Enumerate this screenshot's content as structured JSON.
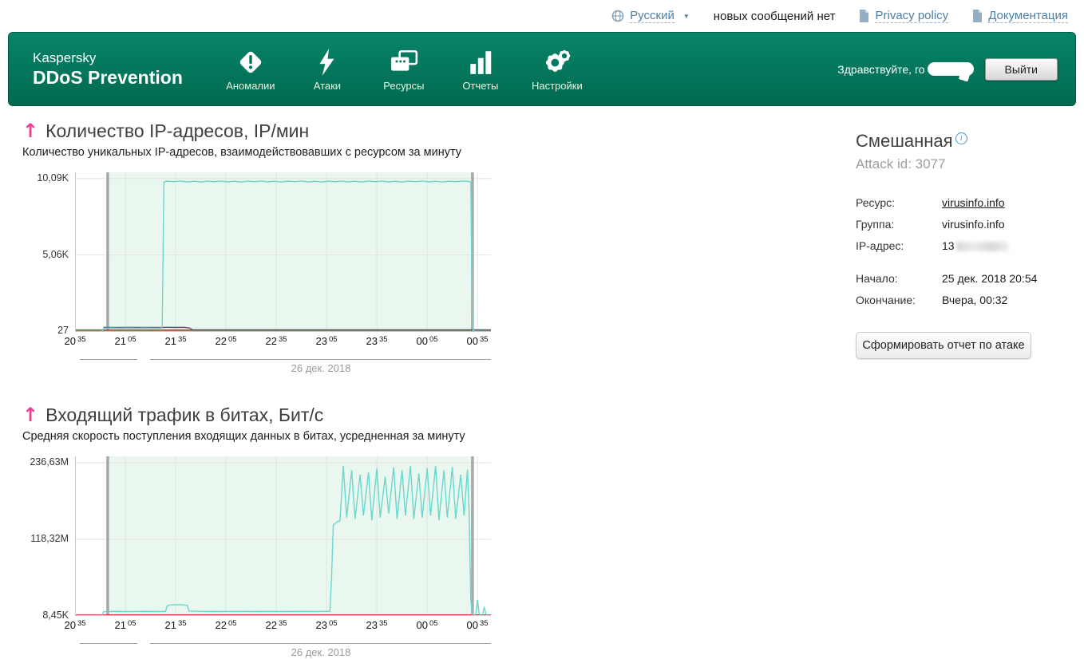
{
  "topbar": {
    "language": "Русский",
    "messages": "новых сообщений нет",
    "privacy": "Privacy policy",
    "docs": "Документация"
  },
  "header": {
    "brand_line1": "Kaspersky",
    "brand_line2": "DDoS Prevention",
    "nav": [
      {
        "label": "Аномалии",
        "icon": "diamond-exclamation"
      },
      {
        "label": "Атаки",
        "icon": "lightning"
      },
      {
        "label": "Ресурсы",
        "icon": "windows"
      },
      {
        "label": "Отчеты",
        "icon": "bar-chart"
      },
      {
        "label": "Настройки",
        "icon": "gears"
      }
    ],
    "greeting": "Здравствуйте, го",
    "logout": "Выйти"
  },
  "sidebar": {
    "title": "Смешанная",
    "attack_id": "Attack id: 3077",
    "fields": [
      {
        "label": "Ресурс:",
        "value": "virusinfo.info"
      },
      {
        "label": "Группа:",
        "value": "virusinfo.info"
      },
      {
        "label": "IP-адрес:",
        "value": "13"
      }
    ],
    "times": [
      {
        "label": "Начало:",
        "value": "25 дек. 2018 20:54"
      },
      {
        "label": "Окончание:",
        "value": "Вчера, 00:32"
      }
    ],
    "report_button": "Сформировать отчет по атаке"
  },
  "chart_data": [
    {
      "type": "line",
      "title": "Количество IP-адресов, IP/мин",
      "subtitle": "Количество уникальных IP-адресов, взаимодействовавших с ресурсом за минуту",
      "date_label": "26 дек. 2018",
      "x_start_time": "20:35",
      "xlim": [
        0,
        248
      ],
      "ylim": [
        0,
        10500
      ],
      "y_ticks": [
        {
          "label": "10,09K",
          "value": 10090
        },
        {
          "label": "5,06K",
          "value": 5060
        },
        {
          "label": "27",
          "value": 27
        }
      ],
      "x_ticks": [
        {
          "h": "20",
          "m": "35",
          "min": 0
        },
        {
          "h": "21",
          "m": "05",
          "min": 30
        },
        {
          "h": "21",
          "m": "35",
          "min": 60
        },
        {
          "h": "22",
          "m": "05",
          "min": 90
        },
        {
          "h": "22",
          "m": "35",
          "min": 120
        },
        {
          "h": "23",
          "m": "05",
          "min": 150
        },
        {
          "h": "23",
          "m": "35",
          "min": 180
        },
        {
          "h": "00",
          "m": "05",
          "min": 210
        },
        {
          "h": "00",
          "m": "35",
          "min": 240
        }
      ],
      "attack_region": {
        "start_min": 19.5,
        "end_min": 237
      },
      "colors": {
        "region": "#e9f7ee",
        "vgrid": "#d9eadf",
        "hgrid": "#e2e2e2",
        "marker": "#a8a8a8"
      },
      "series": [
        {
          "name": "green-baseline",
          "color": "#7cc25c",
          "width": 2,
          "points": [
            [
              0,
              55
            ],
            [
              248,
              55
            ]
          ]
        },
        {
          "name": "red-baseline",
          "color": "#bf4040",
          "width": 1.6,
          "points": [
            [
              0,
              120
            ],
            [
              248,
              120
            ]
          ]
        },
        {
          "name": "navy-line",
          "color": "#4a5b6e",
          "width": 1.4,
          "points": [
            [
              17,
              300
            ],
            [
              25,
              290
            ],
            [
              33,
              298
            ],
            [
              41,
              288
            ],
            [
              49,
              295
            ],
            [
              55,
              300
            ],
            [
              60,
              292
            ],
            [
              65,
              298
            ],
            [
              68,
              260
            ],
            [
              70,
              140
            ],
            [
              80,
              132
            ],
            [
              100,
              135
            ],
            [
              120,
              130
            ],
            [
              140,
              134
            ],
            [
              160,
              130
            ],
            [
              180,
              133
            ],
            [
              200,
              130
            ],
            [
              220,
              133
            ],
            [
              236,
              130
            ],
            [
              248,
              128
            ]
          ]
        },
        {
          "name": "ip-count",
          "color": "#68d7d0",
          "width": 1.4,
          "points": [
            [
              0,
              30
            ],
            [
              6,
              28
            ],
            [
              12,
              30
            ],
            [
              16,
              28
            ],
            [
              17,
              240
            ],
            [
              22,
              252
            ],
            [
              27,
              242
            ],
            [
              32,
              250
            ],
            [
              37,
              244
            ],
            [
              42,
              252
            ],
            [
              47,
              243
            ],
            [
              52,
              250
            ],
            [
              53,
              9860
            ],
            [
              55,
              9920
            ],
            [
              59,
              9880
            ],
            [
              63,
              9930
            ],
            [
              67,
              9870
            ],
            [
              71,
              9910
            ],
            [
              75,
              9860
            ],
            [
              79,
              9920
            ],
            [
              83,
              9880
            ],
            [
              87,
              9930
            ],
            [
              91,
              9870
            ],
            [
              95,
              9910
            ],
            [
              99,
              9860
            ],
            [
              103,
              9920
            ],
            [
              107,
              9880
            ],
            [
              111,
              9930
            ],
            [
              115,
              9870
            ],
            [
              119,
              9910
            ],
            [
              123,
              9860
            ],
            [
              127,
              9920
            ],
            [
              131,
              9880
            ],
            [
              135,
              9930
            ],
            [
              139,
              9870
            ],
            [
              143,
              9910
            ],
            [
              147,
              9860
            ],
            [
              151,
              9920
            ],
            [
              155,
              9880
            ],
            [
              159,
              9930
            ],
            [
              163,
              9870
            ],
            [
              167,
              9910
            ],
            [
              171,
              9860
            ],
            [
              175,
              9920
            ],
            [
              179,
              9880
            ],
            [
              183,
              9930
            ],
            [
              187,
              9870
            ],
            [
              191,
              9910
            ],
            [
              195,
              9860
            ],
            [
              199,
              9920
            ],
            [
              203,
              9880
            ],
            [
              207,
              9930
            ],
            [
              211,
              9870
            ],
            [
              215,
              9910
            ],
            [
              219,
              9860
            ],
            [
              223,
              9920
            ],
            [
              227,
              9880
            ],
            [
              231,
              9930
            ],
            [
              235,
              9890
            ],
            [
              236,
              9860
            ],
            [
              237,
              200
            ],
            [
              238,
              50
            ],
            [
              242,
              35
            ],
            [
              248,
              30
            ]
          ]
        }
      ]
    },
    {
      "type": "line",
      "title": "Входящий трафик в битах, Бит/с",
      "subtitle": "Средняя скорость поступления входящих данных в битах, усредненная за минуту",
      "date_label": "26 дек. 2018",
      "x_start_time": "20:35",
      "unit": "Mbit",
      "xlim": [
        0,
        248
      ],
      "ylim": [
        0,
        246.5
      ],
      "y_ticks": [
        {
          "label": "236,63M",
          "value": 236.63
        },
        {
          "label": "118,32M",
          "value": 118.32
        },
        {
          "label": "8,45K",
          "value": 0.3
        }
      ],
      "x_ticks": [
        {
          "h": "20",
          "m": "35",
          "min": 0
        },
        {
          "h": "21",
          "m": "05",
          "min": 30
        },
        {
          "h": "21",
          "m": "35",
          "min": 60
        },
        {
          "h": "22",
          "m": "05",
          "min": 90
        },
        {
          "h": "22",
          "m": "35",
          "min": 120
        },
        {
          "h": "23",
          "m": "05",
          "min": 150
        },
        {
          "h": "23",
          "m": "35",
          "min": 180
        },
        {
          "h": "00",
          "m": "05",
          "min": 210
        },
        {
          "h": "00",
          "m": "35",
          "min": 240
        }
      ],
      "attack_region": {
        "start_min": 19.5,
        "end_min": 237
      },
      "colors": {
        "region": "#e9f7ee",
        "vgrid": "#d9eadf",
        "hgrid": "#e2e2e2",
        "marker": "#a8a8a8"
      },
      "series": [
        {
          "name": "red-baseline",
          "color": "#dd3b3b",
          "width": 2,
          "points": [
            [
              0,
              1.2
            ],
            [
              248,
              1.2
            ]
          ]
        },
        {
          "name": "traffic-bits",
          "color": "#68d7d0",
          "width": 1.4,
          "points": [
            [
              0,
              0.6
            ],
            [
              16,
              0.6
            ],
            [
              17,
              6.5
            ],
            [
              24,
              7
            ],
            [
              32,
              6.7
            ],
            [
              40,
              7
            ],
            [
              48,
              6.8
            ],
            [
              54,
              7
            ],
            [
              55,
              15.5
            ],
            [
              57,
              17
            ],
            [
              61,
              17.5
            ],
            [
              65,
              17
            ],
            [
              67,
              16
            ],
            [
              68,
              7.5
            ],
            [
              76,
              7
            ],
            [
              86,
              6.8
            ],
            [
              96,
              7
            ],
            [
              106,
              6.8
            ],
            [
              116,
              7
            ],
            [
              126,
              6.8
            ],
            [
              136,
              7
            ],
            [
              146,
              6.9
            ],
            [
              152,
              7.2
            ],
            [
              153,
              60
            ],
            [
              154,
              140
            ],
            [
              156,
              145
            ],
            [
              158,
              147
            ],
            [
              160,
              232
            ],
            [
              162,
              152
            ],
            [
              165,
              225
            ],
            [
              167,
              150
            ],
            [
              170,
              218
            ],
            [
              172,
              155
            ],
            [
              175,
              222
            ],
            [
              177,
              148
            ],
            [
              180,
              228
            ],
            [
              182,
              152
            ],
            [
              185,
              215
            ],
            [
              187,
              158
            ],
            [
              190,
              230
            ],
            [
              192,
              150
            ],
            [
              195,
              225
            ],
            [
              197,
              155
            ],
            [
              200,
              232
            ],
            [
              202,
              150
            ],
            [
              205,
              220
            ],
            [
              207,
              152
            ],
            [
              210,
              228
            ],
            [
              212,
              155
            ],
            [
              215,
              232
            ],
            [
              217,
              148
            ],
            [
              220,
              225
            ],
            [
              222,
              152
            ],
            [
              225,
              230
            ],
            [
              227,
              150
            ],
            [
              230,
              218
            ],
            [
              232,
              155
            ],
            [
              234,
              226
            ],
            [
              235,
              160
            ],
            [
              236,
              25
            ],
            [
              237,
              1
            ],
            [
              238,
              0.6
            ],
            [
              239,
              3
            ],
            [
              240,
              25
            ],
            [
              241,
              3
            ],
            [
              242,
              0.6
            ],
            [
              243,
              0.6
            ],
            [
              244,
              14
            ],
            [
              245,
              3
            ],
            [
              246,
              0.6
            ],
            [
              248,
              0.6
            ]
          ]
        }
      ]
    }
  ]
}
